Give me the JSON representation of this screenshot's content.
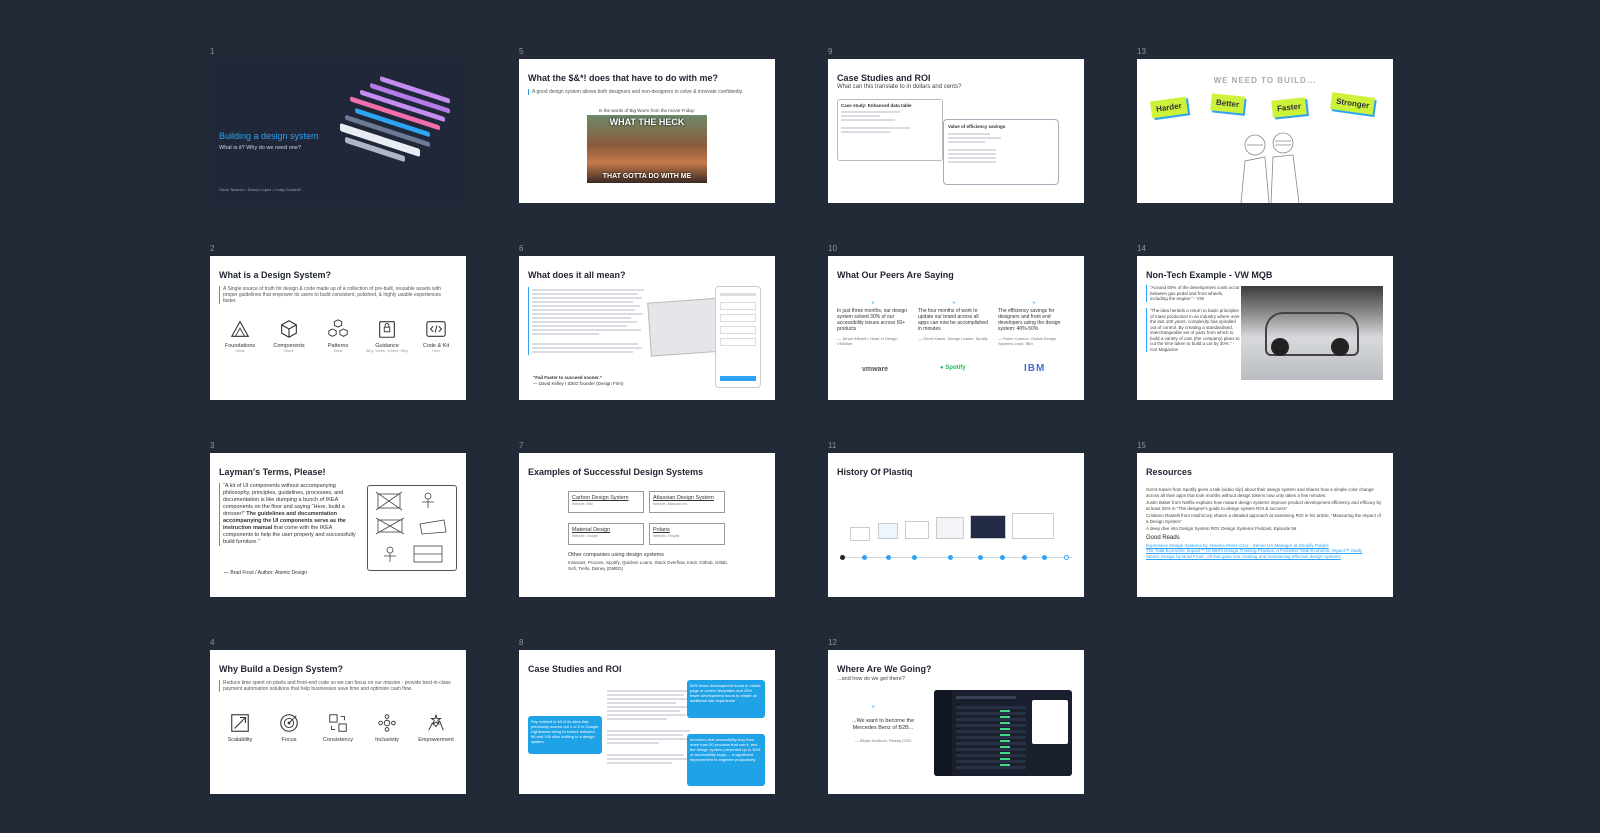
{
  "slides": {
    "s1": {
      "num": "1",
      "title": "Building a design system",
      "subtitle": "What is it? Why do we need one?",
      "authors": "Omar Tavarez  •  Danny Lopez  •  Craig Cockerill"
    },
    "s2": {
      "num": "2",
      "title": "What is a Design System?",
      "body": "A Single source of truth for design & code made up of a collection of pre-built, reusable assets with proper guidelines that empower its users to build consistent, polished, & highly usable experiences faster.",
      "icons": [
        {
          "label": "Foundations",
          "sub": "What"
        },
        {
          "label": "Components",
          "sub": "Block"
        },
        {
          "label": "Patterns",
          "sub": "What"
        },
        {
          "label": "Guidance",
          "sub": "Why, When, Where, Why"
        },
        {
          "label": "Code & Kit",
          "sub": "How"
        }
      ]
    },
    "s3": {
      "num": "3",
      "title": "Layman's Terms, Please!",
      "quote_a": "“A kit of UI components without accompanying philosophy, principles, guidelines, processes, and documentation is like dumping a bunch of IKEA components on the floor and saying “Here, build a dresser!”",
      "quote_b": "The guidelines and documentation accompanying the UI components serve as the instruction manual",
      "quote_c": "that come with the IKEA components to help the user properly and successfully build furniture.”",
      "author": "— Brad Frost / Author: Atomic Design"
    },
    "s4": {
      "num": "4",
      "title": "Why Build a Design System?",
      "body": "Reduce time spent on pixels and front-end code so we can focus on our mission - provide best-in-class payment automation solutions that help businesses save time and optimize cash flow.",
      "icons": [
        "Scalability",
        "Focus",
        "Consistency",
        "Inclusivity",
        "Empowerment"
      ]
    },
    "s5": {
      "num": "5",
      "title": "What the $&*! does that have to do with me?",
      "body": "A good design system allows both designers and non-designers to solve & innovate confidently.",
      "caption": "In the words of Big Worm from the movie Friday:",
      "meme_top": "WHAT THE HECK",
      "meme_bottom": "THAT GOTTA DO WITH ME"
    },
    "s6": {
      "num": "6",
      "title": "What does it all mean?",
      "quote": "“Fail Faster to succeed sooner.”",
      "author": "— David Kelley / IDEO founder (Design Firm)"
    },
    "s7": {
      "num": "7",
      "title": "Examples of Successful Design Systems",
      "systems": [
        {
          "name": "Carbon Design System",
          "sub": "Website, IBM"
        },
        {
          "name": "Atlassian Design System",
          "sub": "Website, Atlassian Inc."
        },
        {
          "name": "Material Design",
          "sub": "Website, Google"
        },
        {
          "name": "Polaris",
          "sub": "Website, Shopify"
        }
      ],
      "others_title": "Other companies using design systems",
      "others": "Instacart, Procore, Spotify, Quicken Loans, Stack Overflow, Intuit, Github, Gitlab, Sofi, Trello, Disney (DMED)"
    },
    "s8": {
      "num": "8",
      "title": "Case Studies and ROI",
      "card1": "50% fewer development hours to create page or screen templates and 25% fewer development hours to create an additional site experience",
      "card2": "Pay noticed in 48 of its sites that previously scored out 1 or 2 in Google Lighthouse rising to scores between 96 and 100 after shifting to a design system",
      "card3": "Immonen that accessibility bug fixes more than 50 products that use it, and the design system prevented up to 30% of accessibility bugs — a significant improvement in engineer productivity"
    },
    "s9": {
      "num": "9",
      "title": "Case Studies and ROI",
      "subtitle": "What can this translate to in dollars and cents?",
      "card_a": "Case study: Enhanced data table",
      "card_b": "Value of efficiency savings"
    },
    "s10": {
      "num": "10",
      "title": "What Our Peers Are Saying",
      "quotes": [
        {
          "text": "In just three months, our design system solved 30% of our accessibility issues across 50+ products",
          "who": "— Jehad Affoneh, Head of Design VMWare",
          "logo": "vmware"
        },
        {
          "text": "The four months of work to update our brand across all apps can now be accomplished in minutes",
          "who": "— Gerrit Kaiser, Design Leader, Spotify",
          "logo": "Spotify"
        },
        {
          "text": "The efficiency savings for designers and front end developers using the design system: 40%-50%",
          "who": "— Robin Cannon, Global Design Systems Lead, IBM",
          "logo": "IBM"
        }
      ]
    },
    "s11": {
      "num": "11",
      "title": "History Of Plastiq"
    },
    "s12": {
      "num": "12",
      "title": "Where Are We Going?",
      "subtitle": "...and how do we get there?",
      "quote": "...We want to become the Mercedes Benz of B2B...",
      "author": "— Eliyan Karlbom, Plastiq COO"
    },
    "s13": {
      "num": "13",
      "heading": "WE NEED TO BUILD...",
      "words": [
        "Harder",
        "Better",
        "Faster",
        "Stronger"
      ]
    },
    "s14": {
      "num": "14",
      "title": "Non-Tech Example - VW MQB",
      "quote1": "“Around 60% of the development costs occur between gas pedal and front wheels, including the engine.” - VW",
      "quote2": "“The idea heralds a return to basic principles of mass production in an industry where over the last 100 years, complexity has spiralled out of control. By creating a standardised, interchangeable set of parts from which to build a variety of cars (the company) plans to cut the time taken to build a car by 30%.” - Car Magazine"
    },
    "s15": {
      "num": "15",
      "title": "Resources",
      "p1": "Gerrit Kaiser from Spotify gives a talk (video clip) about their design system and shares how a simple color change across all their apps that took months without design tokens now only takes a few minutes.",
      "p2": "Justin Baker from Netflix explains how mature design systems improve product development efficiency and efficacy by at least 25% in “The designer's guide to design system ROI & success”",
      "p3": "Cristiano Rastelli from HashiCorp shares a detailed approach at assessing ROI in his article, “Measuring the Impact of a Design System”",
      "p4": "A deep dive into Design System ROI: Design Systems Podcast, Episode 56",
      "reads_title": "Good Reads",
      "r1": "Expressive Design Systems by Yesenia Perez-Cruz - Senior UX Manager at Shopify Polaris",
      "r2": "The Total Economic Impact™ Of IBM's Design Thinking Practice, A Forrester Total Economic Impact™ Study",
      "r3": "Atomic Design by Brad Frost - All that goes into creating and maintaining effective design systems"
    }
  }
}
